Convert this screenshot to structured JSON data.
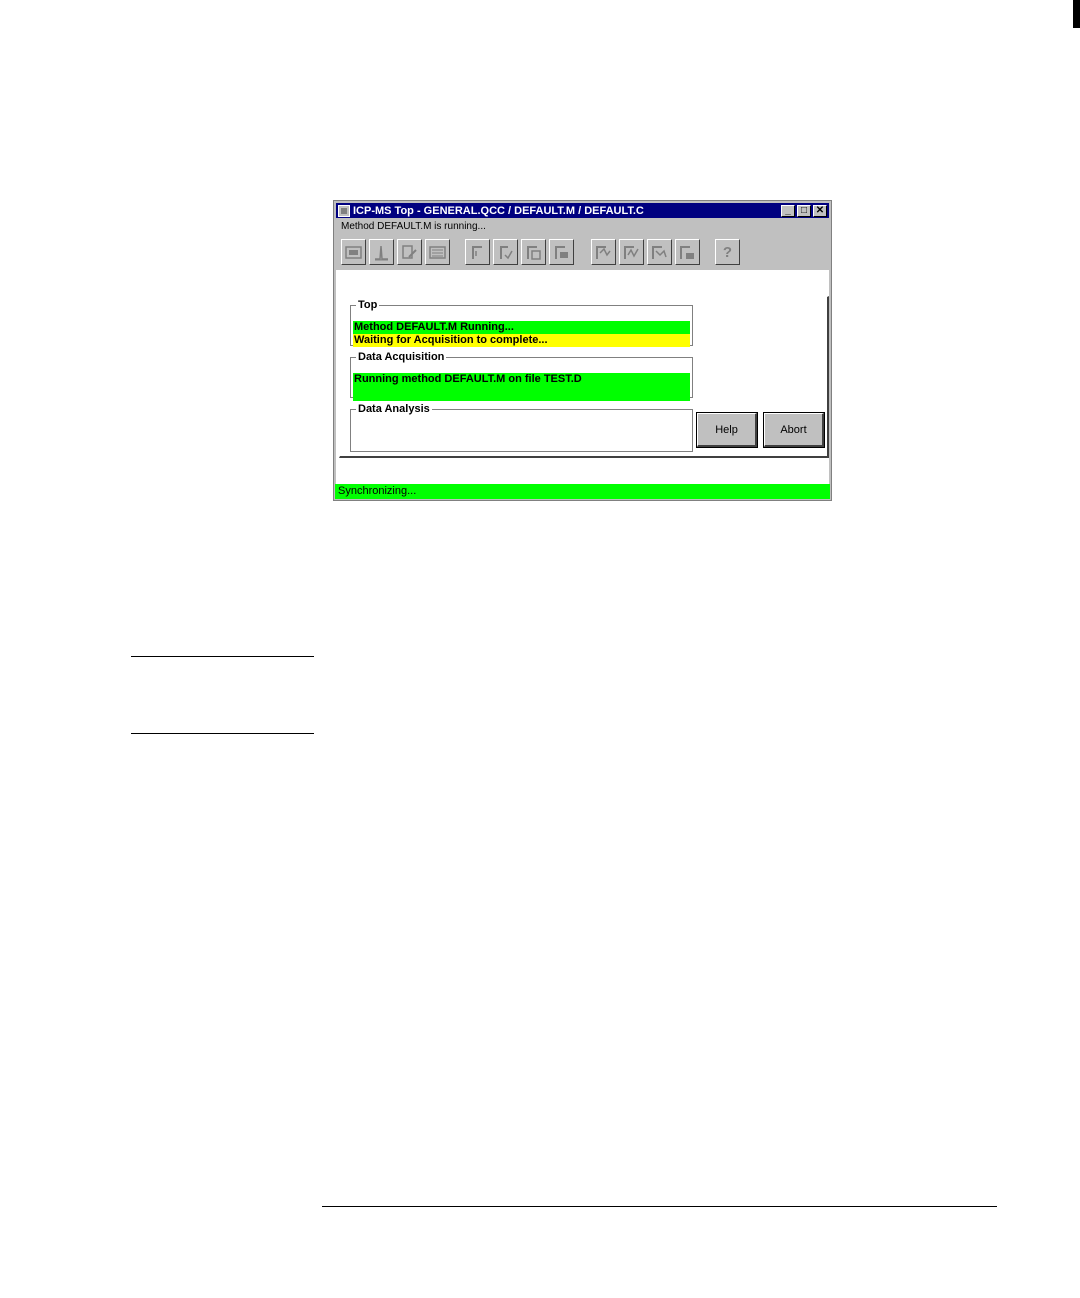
{
  "window": {
    "title": "ICP-MS Top - GENERAL.QCC / DEFAULT.M / DEFAULT.C",
    "status_message": "Method DEFAULT.M is running...",
    "controls": {
      "minimize": "_",
      "maximize": "□",
      "close": "✕"
    }
  },
  "toolbar": {
    "buttons": [
      {
        "icon": "instrument-control-icon"
      },
      {
        "icon": "tune-icon"
      },
      {
        "icon": "method-edit-icon"
      },
      {
        "icon": "sequence-icon"
      },
      {
        "icon": "method-load-icon"
      },
      {
        "icon": "method-run-icon"
      },
      {
        "icon": "method-save-icon"
      },
      {
        "icon": "method-print-icon"
      },
      {
        "icon": "data-load-icon"
      },
      {
        "icon": "data-analysis-icon"
      },
      {
        "icon": "data-review-icon"
      },
      {
        "icon": "data-print-icon"
      },
      {
        "icon": "help-icon",
        "label": "?"
      }
    ]
  },
  "groups": {
    "top": {
      "label": "Top",
      "messages": [
        {
          "text": "Method DEFAULT.M Running...",
          "color": "#00ff00"
        },
        {
          "text": "Waiting for Acquisition to complete...",
          "color": "#ffff00"
        }
      ]
    },
    "data_acquisition": {
      "label": "Data Acquisition",
      "messages": [
        {
          "text": "Running method DEFAULT.M on file TEST.D",
          "color": "#00ff00"
        }
      ]
    },
    "data_analysis": {
      "label": "Data Analysis",
      "messages": []
    }
  },
  "buttons": {
    "help": "Help",
    "abort": "Abort"
  },
  "bottom_status": {
    "text": "Synchronizing...",
    "color": "#00ff00"
  }
}
